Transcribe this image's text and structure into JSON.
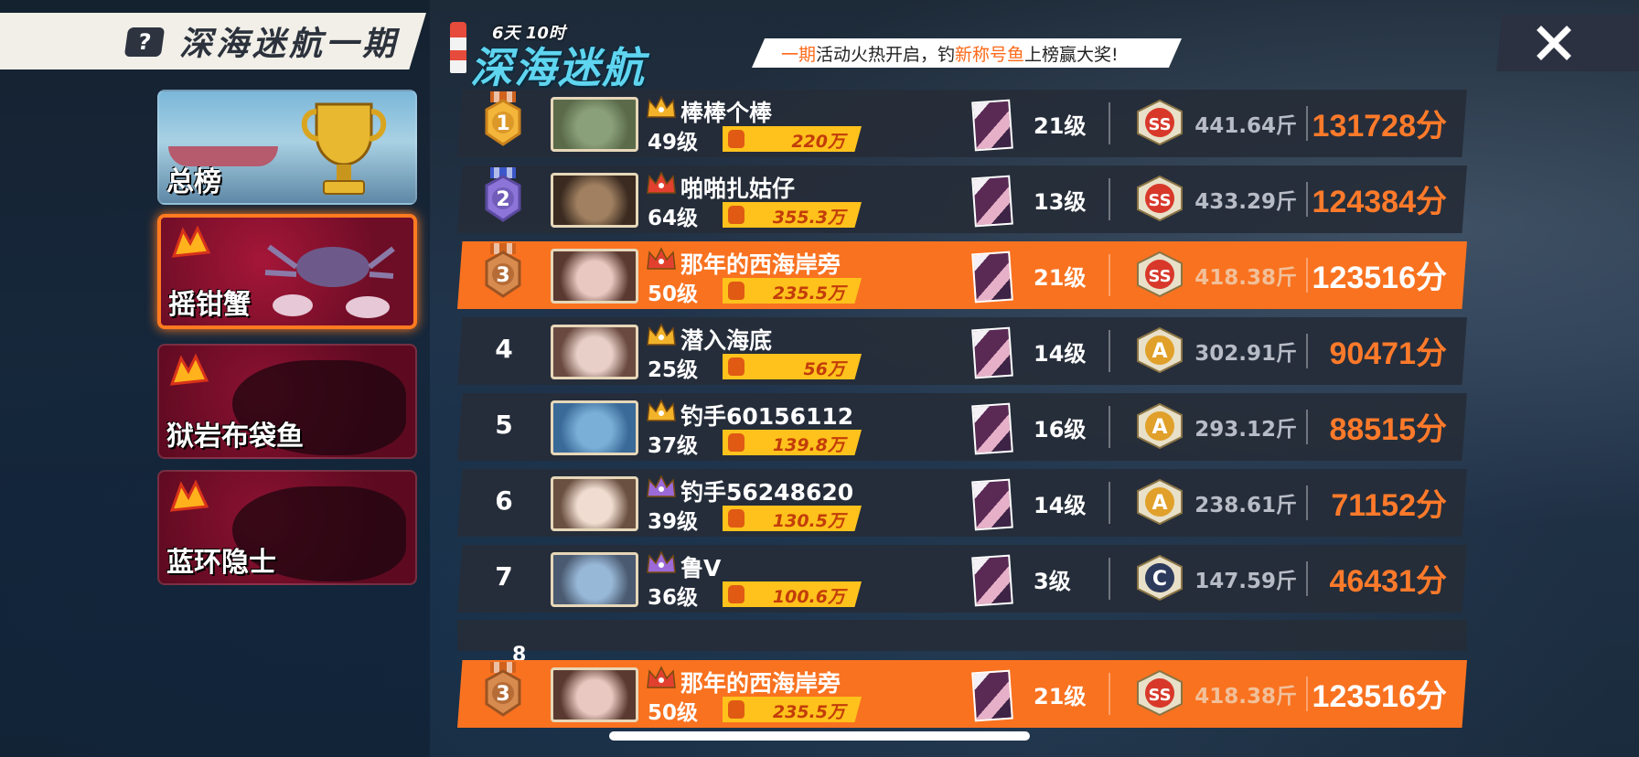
{
  "header": {
    "title": "深海迷航一期",
    "help_icon": "question-icon",
    "event_countdown": "6天 10时",
    "event_logo_text": "深海迷航",
    "banner": {
      "part1": "一期",
      "part2": "活动火热开启，钓",
      "part3": "新称号鱼",
      "part4": "上榜赢大奖!"
    },
    "close_icon": "close-icon"
  },
  "tabs": [
    {
      "label": "总榜",
      "icon": "trophy-icon",
      "selected": false
    },
    {
      "label": "摇钳蟹",
      "icon": "crab-icon",
      "selected": true
    },
    {
      "label": "狱岩布袋鱼",
      "icon": "fish-silhouette-icon",
      "selected": false
    },
    {
      "label": "蓝环隐士",
      "icon": "fish-silhouette-icon",
      "selected": false
    }
  ],
  "rankings": [
    {
      "rank": "1",
      "medal": "gold",
      "name": "棒棒个棒",
      "level": "49级",
      "power": "220万",
      "card_level": "21级",
      "grade": "SS",
      "weight": "441.64斤",
      "score": "131728分",
      "crown": "gold"
    },
    {
      "rank": "2",
      "medal": "purple",
      "name": "啪啪扎姑仔",
      "level": "64级",
      "power": "355.3万",
      "card_level": "13级",
      "grade": "SS",
      "weight": "433.29斤",
      "score": "124384分",
      "crown": "red"
    },
    {
      "rank": "3",
      "medal": "bronze",
      "name": "那年的西海岸旁",
      "level": "50级",
      "power": "235.5万",
      "card_level": "21级",
      "grade": "SS",
      "weight": "418.38斤",
      "score": "123516分",
      "crown": "red",
      "me": true
    },
    {
      "rank": "4",
      "name": "潜入海底",
      "level": "25级",
      "power": "56万",
      "card_level": "14级",
      "grade": "A",
      "weight": "302.91斤",
      "score": "90471分",
      "crown": "gold"
    },
    {
      "rank": "5",
      "name": "钓手60156112",
      "level": "37级",
      "power": "139.8万",
      "card_level": "16级",
      "grade": "A",
      "weight": "293.12斤",
      "score": "88515分",
      "crown": "gold"
    },
    {
      "rank": "6",
      "name": "钓手56248620",
      "level": "39级",
      "power": "130.5万",
      "card_level": "14级",
      "grade": "A",
      "weight": "238.61斤",
      "score": "71152分",
      "crown": "purple"
    },
    {
      "rank": "7",
      "name": "鲁V",
      "level": "36级",
      "power": "100.6万",
      "card_level": "3级",
      "grade": "C",
      "weight": "147.59斤",
      "score": "46431分",
      "crown": "purple"
    }
  ],
  "partial_row": {
    "rank": "8"
  },
  "my_rank": {
    "rank": "3",
    "medal": "bronze",
    "name": "那年的西海岸旁",
    "level": "50级",
    "power": "235.5万",
    "card_level": "21级",
    "grade": "SS",
    "weight": "418.38斤",
    "score": "123516分"
  },
  "colors": {
    "accent": "#f97220",
    "score": "#ff7a2a",
    "power_bar": "#ffc21c",
    "row_bg": "#262c38",
    "selected_tab_glow": "#ff7a20"
  }
}
